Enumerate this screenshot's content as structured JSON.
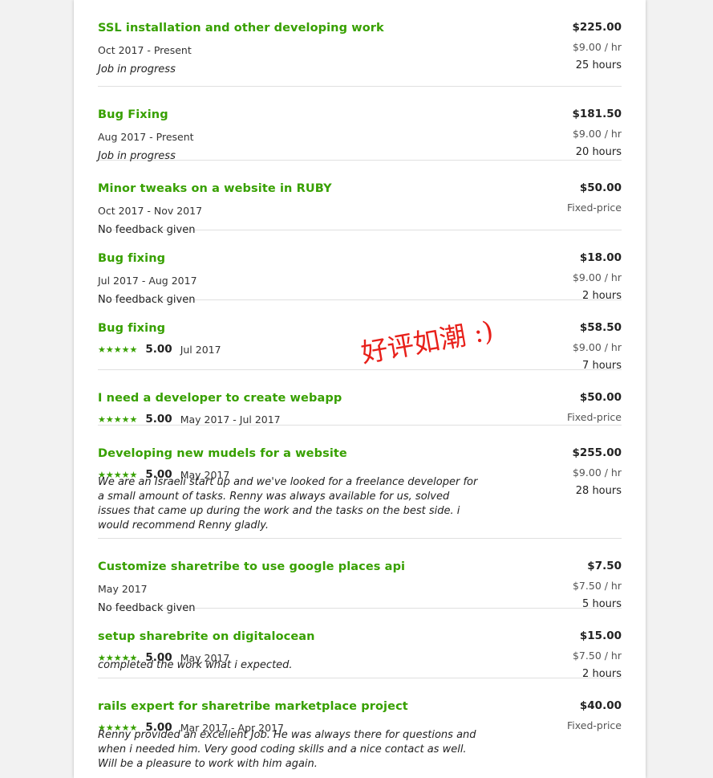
{
  "jobs": [
    {
      "title": "SSL installation and other developing work",
      "dates": "Oct 2017 - Present",
      "status": "Job in progress",
      "status_style": "italic",
      "amount": "$225.00",
      "rate": "$9.00 / hr",
      "hours": "25 hours"
    },
    {
      "title": "Bug Fixing",
      "dates": "Aug 2017 - Present",
      "status": "Job in progress",
      "status_style": "italic",
      "amount": "$181.50",
      "rate": "$9.00 / hr",
      "hours": "20 hours"
    },
    {
      "title": "Minor tweaks on a website in RUBY",
      "dates": "Oct 2017 - Nov 2017",
      "status": "No feedback given",
      "status_style": "normal",
      "amount": "$50.00",
      "rate": "Fixed-price"
    },
    {
      "title": "Bug fixing",
      "dates": "Jul 2017 - Aug 2017",
      "status": "No feedback given",
      "status_style": "normal",
      "amount": "$18.00",
      "rate": "$9.00 / hr",
      "hours": "2 hours"
    },
    {
      "title": "Bug fixing",
      "stars": 5,
      "score": "5.00",
      "dates": "Jul 2017",
      "amount": "$58.50",
      "rate": "$9.00 / hr",
      "hours": "7 hours"
    },
    {
      "title": "I need a developer to create webapp",
      "stars": 5,
      "score": "5.00",
      "dates": "May 2017 - Jul 2017",
      "amount": "$50.00",
      "rate": "Fixed-price"
    },
    {
      "title": "Developing new mudels for a website",
      "stars": 5,
      "score": "5.00",
      "dates": "May 2017",
      "feedback": "We are an Israeli start up and we've looked for a freelance developer for a small amount of tasks. Renny was always available for us, solved issues that came up during the work and the tasks on the best side. i would recommend Renny gladly.",
      "amount": "$255.00",
      "rate": "$9.00 / hr",
      "hours": "28 hours"
    },
    {
      "title": "Customize sharetribe to use google places api",
      "dates": "May 2017",
      "status": "No feedback given",
      "status_style": "normal",
      "amount": "$7.50",
      "rate": "$7.50 / hr",
      "hours": "5 hours"
    },
    {
      "title": "setup sharebrite on digitalocean",
      "stars": 5,
      "score": "5.00",
      "dates": "May 2017",
      "feedback": "completed the work what i expected.",
      "amount": "$15.00",
      "rate": "$7.50 / hr",
      "hours": "2 hours"
    },
    {
      "title": "rails expert for sharetribe marketplace project",
      "stars": 5,
      "score": "5.00",
      "dates": "Mar 2017 - Apr 2017",
      "feedback": "Renny provided an excellent Job. He was always there for questions and when i needed him. Very good coding skills and a nice contact as well. Will be a pleasure to work with him again.",
      "amount": "$40.00",
      "rate": "Fixed-price"
    }
  ],
  "annotation": "好评如潮 :)",
  "colors": {
    "title": "#37a000",
    "annotation": "#e8201a"
  },
  "icons": {
    "star": "star-icon"
  }
}
